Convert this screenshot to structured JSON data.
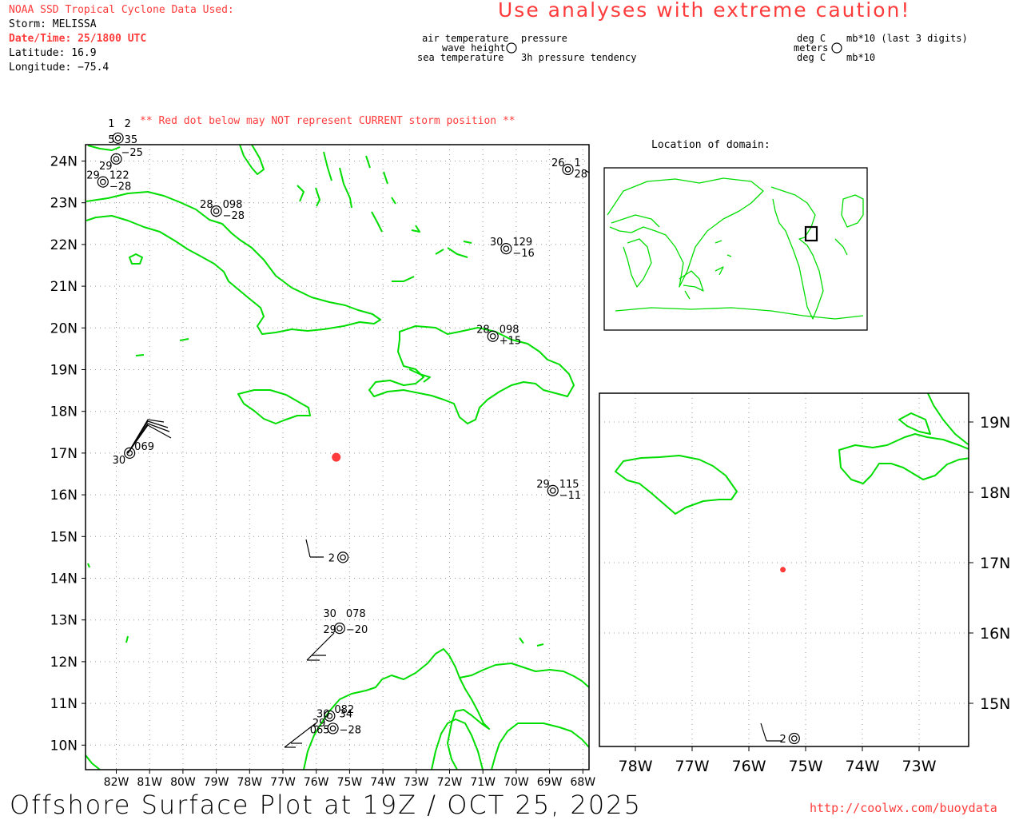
{
  "header": {
    "source_line": "NOAA SSD Tropical Cyclone Data Used:",
    "storm_line": "Storm: MELISSA",
    "datetime_line": "Date/Time: 25/1800 UTC",
    "latitude_line": "Latitude: 16.9",
    "longitude_line": "Longitude: −75.4",
    "caution": "Use analyses with extreme caution!"
  },
  "legend": {
    "left_top_left": "air temperature",
    "left_top_right": "pressure",
    "left_mid": "wave height",
    "left_bottom_left": "sea temperature",
    "left_bottom_right": "3h pressure tendency",
    "right_top_left": "deg C",
    "right_top_right": "mb*10 (last 3 digits)",
    "right_mid": "meters",
    "right_bottom_left": "deg C",
    "right_bottom_right": "mb*10"
  },
  "red_dot_note": "** Red dot below may NOT represent CURRENT storm position **",
  "inset_title": "Location of domain:",
  "footer": {
    "title": "Offshore Surface Plot at 19Z / OCT 25, 2025",
    "url": "http://coolwx.com/buoydata"
  },
  "colors": {
    "land": "#00dd00",
    "storm": "#ff3b3b",
    "grid": "#9a9a9a",
    "frame": "#000000"
  },
  "main_map": {
    "lat_labels": [
      "24N",
      "23N",
      "22N",
      "21N",
      "20N",
      "19N",
      "18N",
      "17N",
      "16N",
      "15N",
      "14N",
      "13N",
      "12N",
      "11N",
      "10N"
    ],
    "lon_labels": [
      "82W",
      "81W",
      "80W",
      "79W",
      "78W",
      "77W",
      "76W",
      "75W",
      "74W",
      "73W",
      "72W",
      "71W",
      "70W",
      "69W",
      "68W"
    ],
    "storm": {
      "lat": 16.9,
      "lon": -75.4
    },
    "stations": [
      {
        "lat": 24.55,
        "lon": -81.95,
        "texts": [
          "1",
          "2",
          "5",
          "35"
        ]
      },
      {
        "lat": 24.05,
        "lon": -82.0,
        "texts": [
          "29",
          "−25"
        ]
      },
      {
        "lat": 23.5,
        "lon": -82.4,
        "texts": [
          "29",
          "122",
          "−28"
        ]
      },
      {
        "lat": 22.8,
        "lon": -79.0,
        "texts": [
          "28",
          "098",
          "−28"
        ]
      },
      {
        "lat": 21.9,
        "lon": -70.3,
        "texts": [
          "30",
          "129",
          "−16"
        ]
      },
      {
        "lat": 19.8,
        "lon": -70.7,
        "texts": [
          "28",
          "098",
          "+15"
        ]
      },
      {
        "lat": 16.1,
        "lon": -68.9,
        "texts": [
          "29",
          "115",
          "−11"
        ]
      },
      {
        "lat": 23.8,
        "lon": -68.45,
        "texts": [
          "26",
          "1",
          "28"
        ]
      },
      {
        "lat": 17.0,
        "lon": -81.6,
        "texts": [
          "30",
          "069"
        ]
      },
      {
        "lat": 14.5,
        "lon": -75.2,
        "texts": [
          "2"
        ]
      },
      {
        "lat": 12.8,
        "lon": -75.3,
        "texts": [
          "30",
          "078",
          "29",
          "−20"
        ]
      },
      {
        "lat": 10.7,
        "lon": -75.6,
        "texts": [
          "29",
          "082"
        ]
      },
      {
        "lat": 10.4,
        "lon": -75.5,
        "texts": [
          "30",
          "34",
          "065",
          "−28"
        ]
      }
    ]
  },
  "zoom_map": {
    "lat_labels": [
      "19N",
      "18N",
      "17N",
      "16N",
      "15N"
    ],
    "lon_labels": [
      "78W",
      "77W",
      "76W",
      "75W",
      "74W",
      "73W"
    ],
    "storm": {
      "lat": 16.9,
      "lon": -75.4
    },
    "stations": [
      {
        "lat": 14.5,
        "lon": -75.2,
        "texts": [
          "2"
        ]
      }
    ]
  }
}
